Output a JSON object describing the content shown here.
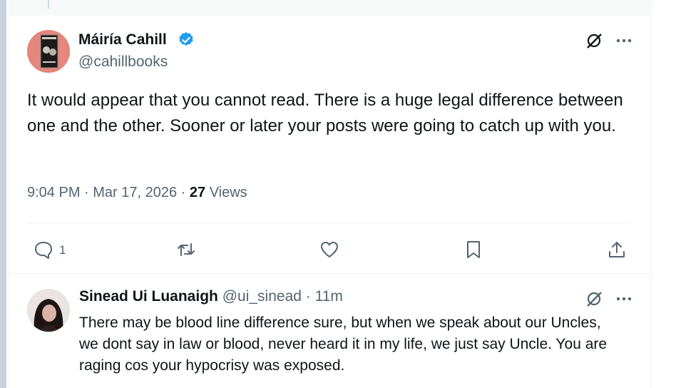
{
  "main_tweet": {
    "author_name": "Máiría Cahill",
    "author_handle": "@cahillbooks",
    "text": "It would appear that you cannot read. There is a huge legal difference between one and the other. Sooner or later your posts were going to catch up with you.",
    "time": "9:04 PM · Mar 17, 2026 · ",
    "views_count": "27",
    "views_label": " Views",
    "reply_count": "1"
  },
  "reply_tweet": {
    "author_name": "Sinead Ui Luanaigh",
    "author_handle": "@ui_sinead",
    "separator": " · ",
    "age": "11m",
    "text": "There may be blood line difference sure, but when we speak about our Uncles, we dont say in law or blood, never heard it in my life, we just say Uncle.  You are raging cos your hypocrisy was exposed."
  },
  "icons": {
    "verified": "verified-badge-icon",
    "grok": "grok-icon",
    "more": "more-icon",
    "reply": "reply-icon",
    "repost": "repost-icon",
    "like": "like-icon",
    "bookmark": "bookmark-icon",
    "share": "share-icon"
  },
  "colors": {
    "accent": "#1d9bf0",
    "text": "#0f1419",
    "secondary": "#536471"
  }
}
